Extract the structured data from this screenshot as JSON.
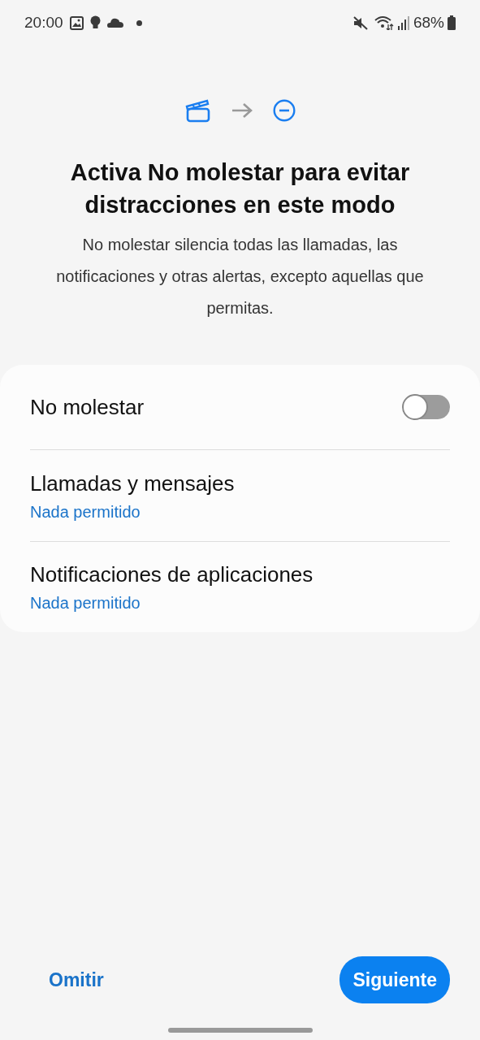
{
  "status_bar": {
    "time": "20:00",
    "battery": "68%"
  },
  "title": "Activa No molestar para evitar distracciones en este modo",
  "description": "No molestar silencia todas las llamadas, las notificaciones y otras alertas, excepto aquellas que permitas.",
  "settings": [
    {
      "kind": "toggle",
      "label": "No molestar",
      "on": false
    },
    {
      "kind": "link",
      "label": "Llamadas y mensajes",
      "value": "Nada permitido"
    },
    {
      "kind": "link",
      "label": "Notificaciones de aplicaciones",
      "value": "Nada permitido"
    }
  ],
  "buttons": {
    "skip": "Omitir",
    "next": "Siguiente"
  }
}
